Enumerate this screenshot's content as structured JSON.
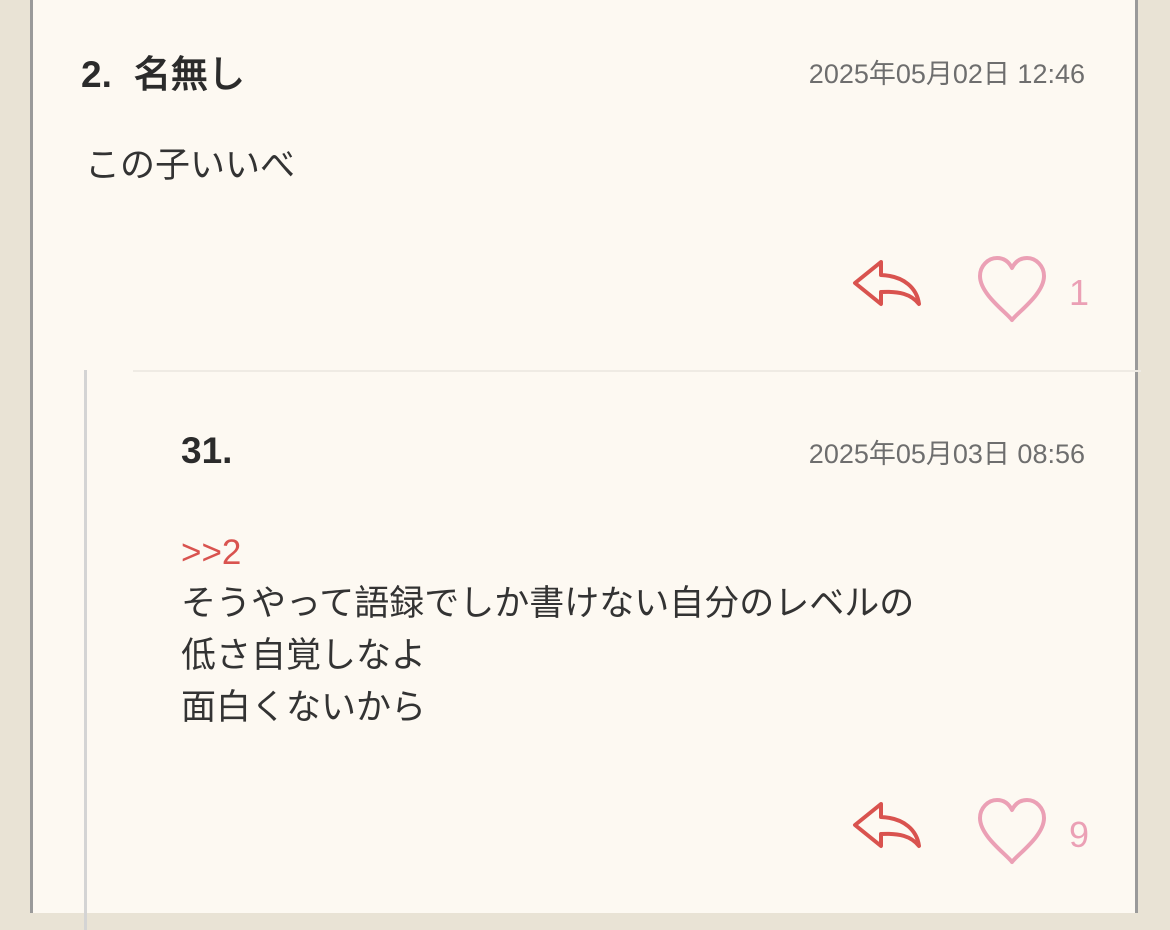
{
  "comments": [
    {
      "number": "2.",
      "name": "名無し",
      "date": "2025年05月02日 12:46",
      "body": "この子いいべ",
      "likes": "1"
    },
    {
      "number": "31.",
      "name": "",
      "date": "2025年05月03日 08:56",
      "anchor": ">>2",
      "body_lines": [
        "そうやって語録でしか書けない自分のレベルの",
        "低さ自覚しなよ",
        "面白くないから"
      ],
      "likes": "9"
    }
  ],
  "icons": {
    "reply": "reply-arrow-icon",
    "like": "heart-outline-icon"
  },
  "colors": {
    "background": "#e9e3d5",
    "card": "#fdf9f2",
    "accent_red": "#d9534f",
    "heart_pink": "#eba0b5",
    "text": "#333333",
    "date": "#6e6e6e"
  }
}
